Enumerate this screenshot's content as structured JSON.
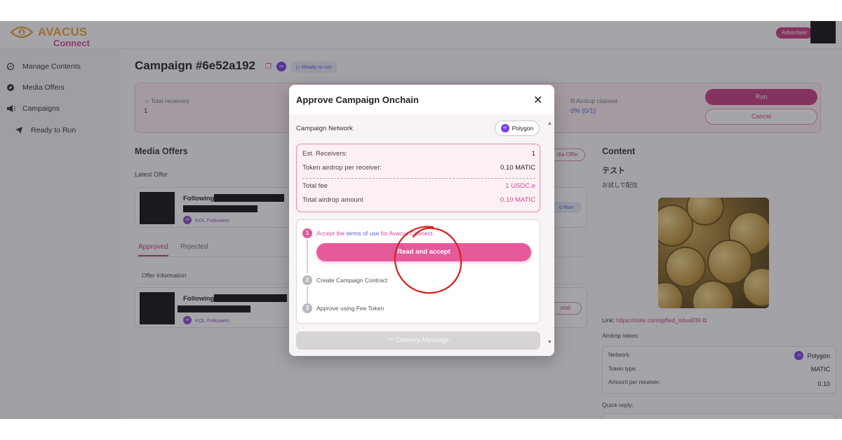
{
  "brand": {
    "name": "AVACUS",
    "sub": "Connect"
  },
  "header": {
    "role_badge": "Advertiser"
  },
  "sidebar": {
    "items": [
      {
        "label": "Manage Contents",
        "icon": "chat-icon"
      },
      {
        "label": "Media Offers",
        "icon": "compass-icon"
      },
      {
        "label": "Campaigns",
        "icon": "megaphone-icon"
      },
      {
        "label": "Ready to Run",
        "icon": "send-icon"
      }
    ]
  },
  "campaign": {
    "title": "Campaign #6e52a192",
    "status": "Ready to run",
    "stats": {
      "total_receivers_label": "Total receivers",
      "total_receivers_value": "1",
      "airdrop_claimed_label": "Airdrop claimed",
      "airdrop_claimed_value": "0% (0/1)"
    },
    "run_label": "Run",
    "cancel_label": "Cancel"
  },
  "media_offers": {
    "title": "Media Offers",
    "latest_offer_label": "Latest Offer",
    "add_button_partial": "dia Offer",
    "offer_name": "Following",
    "offer_tag": "KOL Followers",
    "status_partial": "o Run",
    "tabs": [
      "Approved",
      "Rejected"
    ],
    "offer_info_label": "Offer Information",
    "detail_partial": "etail"
  },
  "content": {
    "title": "Content",
    "post_title": "テスト",
    "post_body": "お試しで配信",
    "link_label": "Link:",
    "link_url": "https://note.com/gifted_lotus939",
    "airdrop_token_label": "Airdrop token:",
    "network_label": "Network:",
    "network_value": "Polygon",
    "token_type_label": "Token type:",
    "token_type_value": "MATIC",
    "amount_label": "Amount per receiver:",
    "amount_value": "0.10",
    "quick_reply_label": "Quick reply:"
  },
  "modal": {
    "title": "Approve Campaign Onchain",
    "network_label": "Campaign Network",
    "network_value": "Polygon",
    "fees": {
      "est_receivers_label": "Est. Receivers:",
      "est_receivers_value": "1",
      "per_receiver_label": "Token airdrop per receiver:",
      "per_receiver_value": "0.10 MATIC",
      "total_fee_label": "Total fee",
      "total_fee_value": "1 USDC.e",
      "total_airdrop_label": "Total airdrop amount",
      "total_airdrop_value": "0.10 MATIC"
    },
    "steps": [
      {
        "num": "1",
        "prefix": "Accept the ",
        "link": "terms of use",
        "suffix": " for Avacus Connect."
      },
      {
        "num": "2",
        "text": "Create Campaign Contract"
      },
      {
        "num": "3",
        "text": "Approve using Fee Token"
      }
    ],
    "accept_button": "Read and accept",
    "delivery_button": "Delivery Message"
  },
  "colors": {
    "brand_pink": "#c63c80",
    "brand_gold": "#e8a33a",
    "polygon_purple": "#7b3fe4",
    "annotation_red": "#d42020"
  }
}
